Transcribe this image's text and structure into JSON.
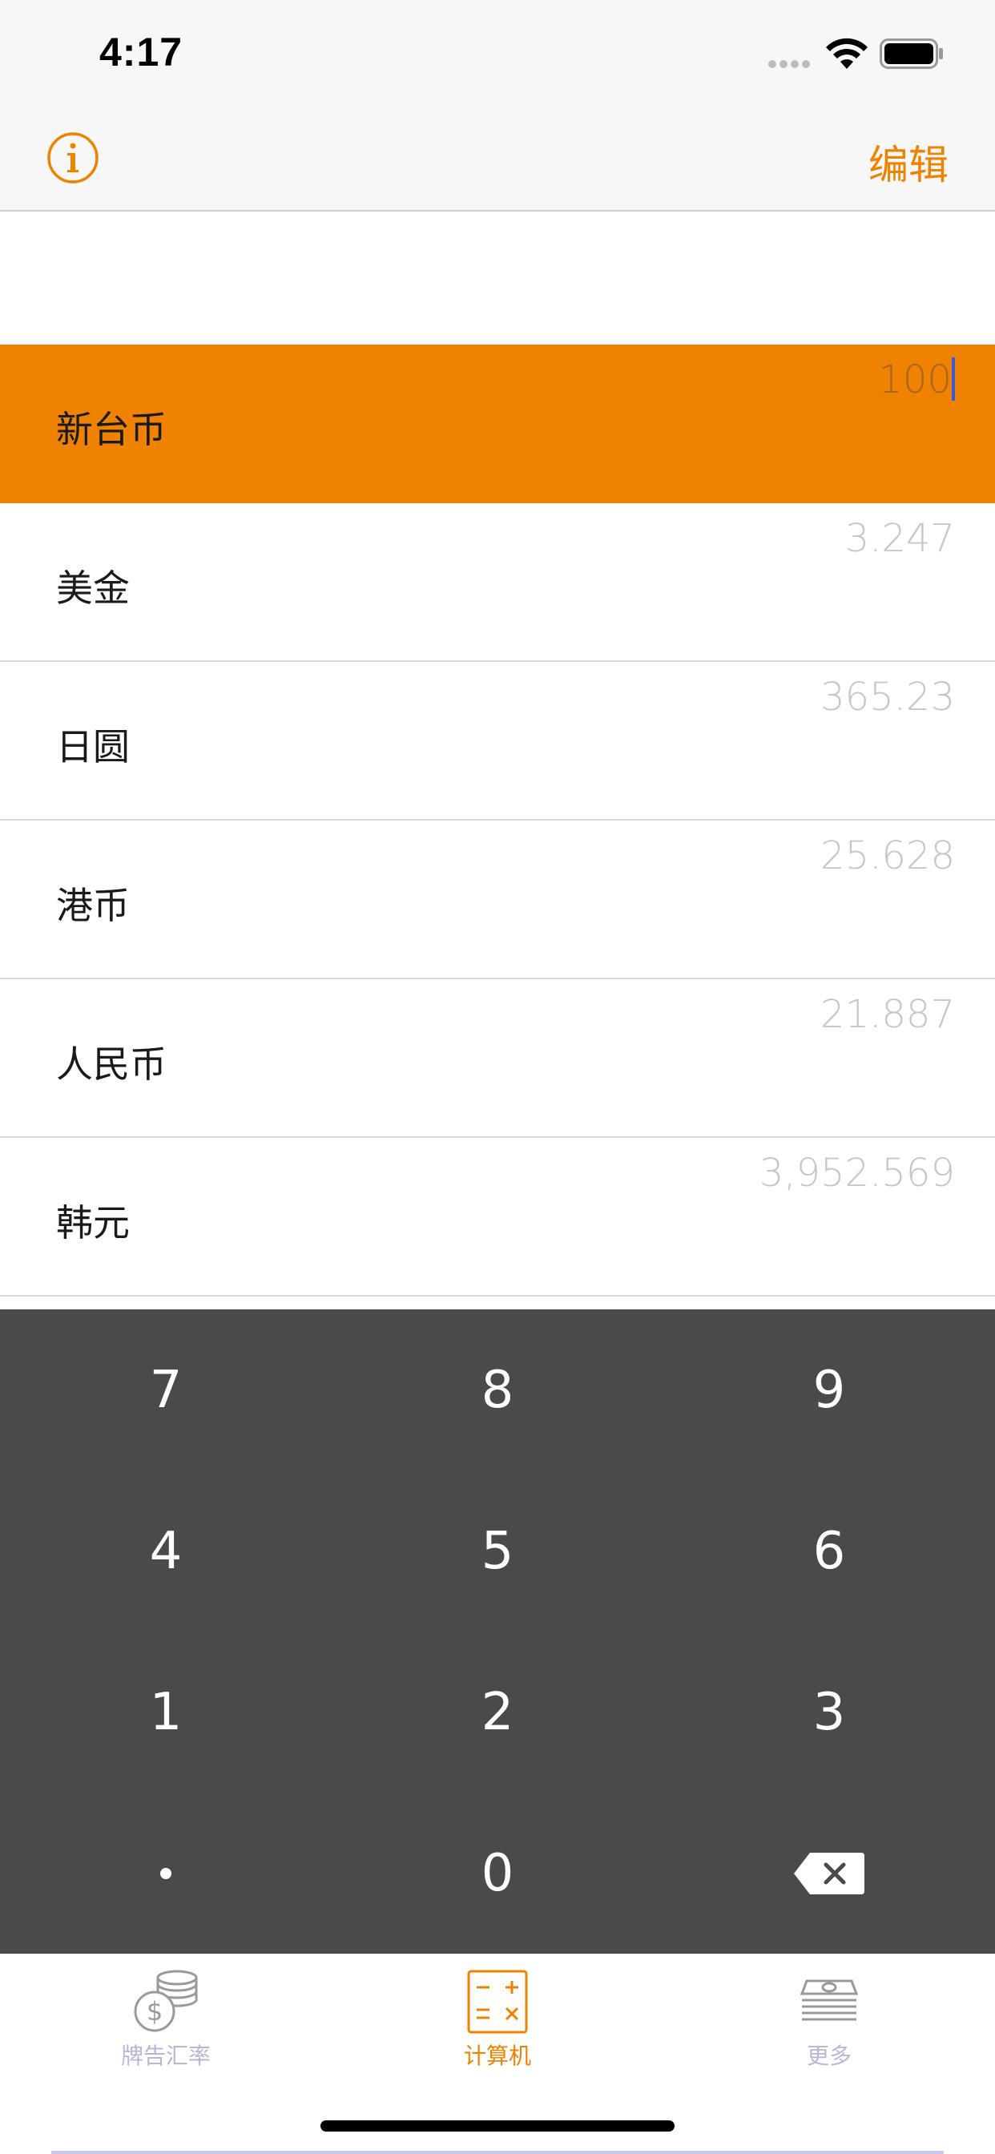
{
  "status_bar": {
    "time": "4:17"
  },
  "nav": {
    "edit_label": "编辑",
    "info_icon": "info-icon"
  },
  "colors": {
    "accent": "#ef8200",
    "keypad_bg": "#4a4a4a",
    "value_gray": "#c7c7c7",
    "tab_inactive": "#b7b6d6"
  },
  "currencies": [
    {
      "name": "新台币",
      "value": "100",
      "active": true
    },
    {
      "name": "美金",
      "value": "3.247",
      "active": false
    },
    {
      "name": "日圆",
      "value": "365.23",
      "active": false
    },
    {
      "name": "港币",
      "value": "25.628",
      "active": false
    },
    {
      "name": "人民币",
      "value": "21.887",
      "active": false
    },
    {
      "name": "韩元",
      "value": "3,952.569",
      "active": false
    }
  ],
  "keypad": {
    "keys": [
      "7",
      "8",
      "9",
      "4",
      "5",
      "6",
      "1",
      "2",
      "3",
      ".",
      "0",
      "backspace"
    ]
  },
  "tabs": [
    {
      "label": "牌告汇率",
      "icon": "coins-dollar-icon",
      "active": false
    },
    {
      "label": "计算机",
      "icon": "calculator-icon",
      "active": true
    },
    {
      "label": "更多",
      "icon": "cash-stack-icon",
      "active": false
    }
  ]
}
